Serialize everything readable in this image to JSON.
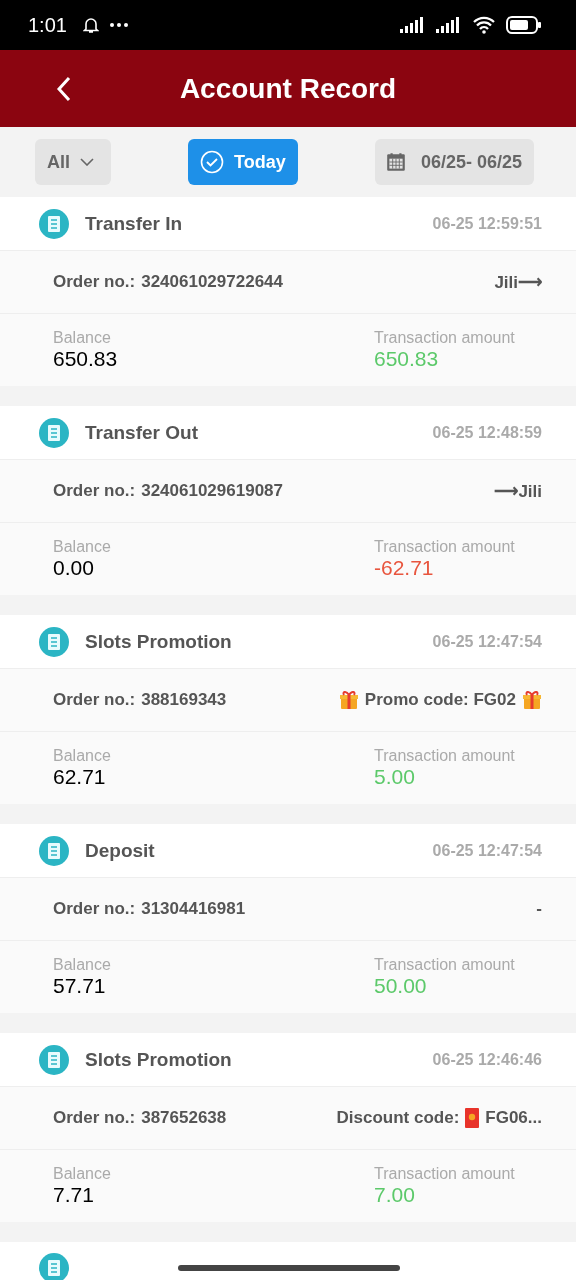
{
  "status_bar": {
    "time": "1:01"
  },
  "header": {
    "title": "Account Record"
  },
  "filters": {
    "type": "All",
    "today": {
      "label": "Today",
      "selected": true
    },
    "date_range": "06/25- 06/25"
  },
  "records": [
    {
      "title": "Transfer In",
      "time": "06-25 12:59:51",
      "order_label": "Order no.:",
      "order_no": "324061029722644",
      "tag": {
        "kind": "plain",
        "text": "Jili⟶"
      },
      "balance_label": "Balance",
      "balance": "650.83",
      "amount_label": "Transaction amount",
      "amount": "650.83",
      "color": "#5cc96a"
    },
    {
      "title": "Transfer Out",
      "time": "06-25 12:48:59",
      "order_label": "Order no.:",
      "order_no": "324061029619087",
      "tag": {
        "kind": "plain",
        "text": "⟶Jili"
      },
      "balance_label": "Balance",
      "balance": "0.00",
      "amount_label": "Transaction amount",
      "amount": "-62.71",
      "color": "#e8553e"
    },
    {
      "title": "Slots Promotion",
      "time": "06-25 12:47:54",
      "order_label": "Order no.:",
      "order_no": "388169343",
      "tag": {
        "kind": "promo",
        "text": "Promo code: FG02"
      },
      "balance_label": "Balance",
      "balance": "62.71",
      "amount_label": "Transaction amount",
      "amount": "5.00",
      "color": "#5cc96a"
    },
    {
      "title": "Deposit",
      "time": "06-25 12:47:54",
      "order_label": "Order no.:",
      "order_no": "31304416981",
      "tag": {
        "kind": "plain",
        "text": "-"
      },
      "balance_label": "Balance",
      "balance": "57.71",
      "amount_label": "Transaction amount",
      "amount": "50.00",
      "color": "#5cc96a"
    },
    {
      "title": "Slots Promotion",
      "time": "06-25 12:46:46",
      "order_label": "Order no.:",
      "order_no": "387652638",
      "tag": {
        "kind": "discount",
        "text": "Discount code:",
        "code": "FG06..."
      },
      "balance_label": "Balance",
      "balance": "7.71",
      "amount_label": "Transaction amount",
      "amount": "7.00",
      "color": "#5cc96a"
    }
  ]
}
